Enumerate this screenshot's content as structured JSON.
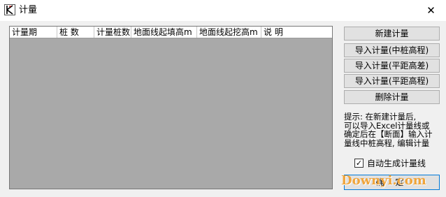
{
  "window": {
    "title": "计量",
    "close_symbol": "✕"
  },
  "table": {
    "columns": [
      "计量期",
      "桩 数",
      "计量桩数",
      "地面线起填高m",
      "地面线起挖高m",
      "说 明"
    ],
    "rows": []
  },
  "buttons": {
    "new": "新建计量",
    "import_center": "导入计量(中桩高程)",
    "import_flat_diff": "导入计量(平距高差)",
    "import_flat_elev": "导入计量(平距高程)",
    "delete": "删除计量"
  },
  "hint": "提示: 在新建计量后,\n可以导入Excel计量线或\n确定后在【断面】输入计\n量线中桩高程, 编辑计量",
  "auto_generate": {
    "label": "自动生成计量线",
    "checked": true,
    "check_glyph": "✓"
  },
  "ok_button": "确 定",
  "watermark": "Downyi.com"
}
